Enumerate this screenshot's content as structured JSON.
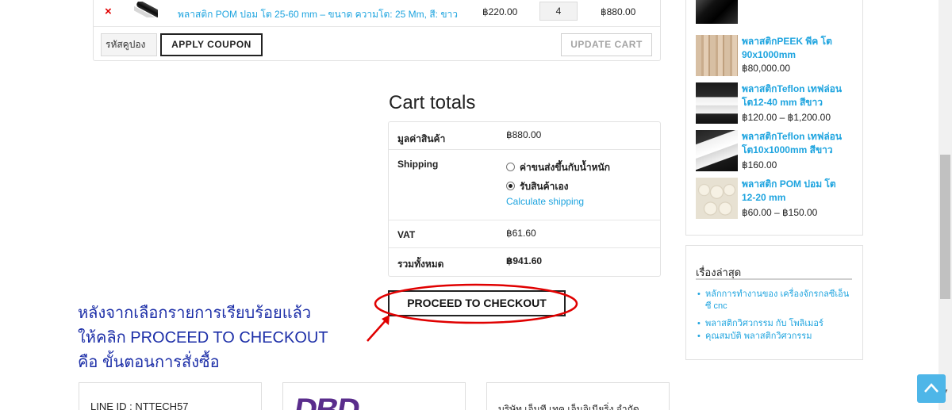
{
  "cart": {
    "item": {
      "remove": "×",
      "name": "พลาสติก POM ปอม โต 25-60 mm – ขนาด ความโต: 25 Mm, สี: ขาว",
      "price": "฿220.00",
      "quantity": "4",
      "subtotal": "฿880.00"
    },
    "coupon_placeholder": "รหัสคูปอง",
    "apply_coupon": "APPLY COUPON",
    "update_cart": "UPDATE CART"
  },
  "totals": {
    "title": "Cart totals",
    "subtotal_label": "มูลค่าสินค้า",
    "subtotal_value": "฿880.00",
    "shipping_label": "Shipping",
    "shipping_option1": "ค่าขนส่งขึ้นกับน้ำหนัก",
    "shipping_option2": "รับสินค้าเอง",
    "shipping_selected": "รับสินค้าเอง",
    "calc_shipping": "Calculate shipping",
    "vat_label": "VAT",
    "vat_value": "฿61.60",
    "total_label": "รวมทั้งหมด",
    "total_value": "฿941.60",
    "checkout": "PROCEED TO CHECKOUT"
  },
  "annotation": {
    "line1": "หลังจากเลือกรายการเรียบร้อยแล้ว",
    "line2": "ให้คลิก PROCEED TO CHECKOUT",
    "line3": "คือ ขั้นตอนการสั่งซื้อ",
    "color": "#e00000"
  },
  "footer": {
    "line_id": "LINE ID : NTTECH57",
    "logo": "DBD",
    "company": "บริษัท เอ็นที เทค เอ็นจิเนียริ่ง จำกัด"
  },
  "sidebar": {
    "products": [
      {
        "title": "",
        "price": "",
        "icon": "black-plastic-image"
      },
      {
        "title": "พลาสติกPEEK พีค โต 90x1000mm",
        "price": "฿80,000.00",
        "icon": "peek-rod-image"
      },
      {
        "title": "พลาสติกTeflon เทฟล่อน โต12-40 mm สีขาว",
        "price": "฿120.00 – ฿1,200.00",
        "icon": "teflon-rod-image"
      },
      {
        "title": "พลาสติกTeflon เทฟล่อน โต10x1000mm สีขาว",
        "price": "฿160.00",
        "icon": "teflon-rod-image"
      },
      {
        "title": "พลาสติก POM ปอม โต 12-20 mm",
        "price": "฿60.00 – ฿150.00",
        "icon": "pom-rod-image"
      }
    ],
    "recent_heading": "เรื่องล่าสุด",
    "recent_posts": [
      "หลักการทำงานของ เครื่องจักรกลซีเอ็นซี cnc",
      "พลาสติกวิศวกรรม กับ โพลิเมอร์",
      "คุณสมบัติ พลาสติกวิศวกรรม"
    ]
  },
  "colors": {
    "link": "#1ea4df",
    "remove": "#e10000",
    "annotation_text": "#1d2fa8",
    "back_to_top": "#4eb6e8"
  }
}
